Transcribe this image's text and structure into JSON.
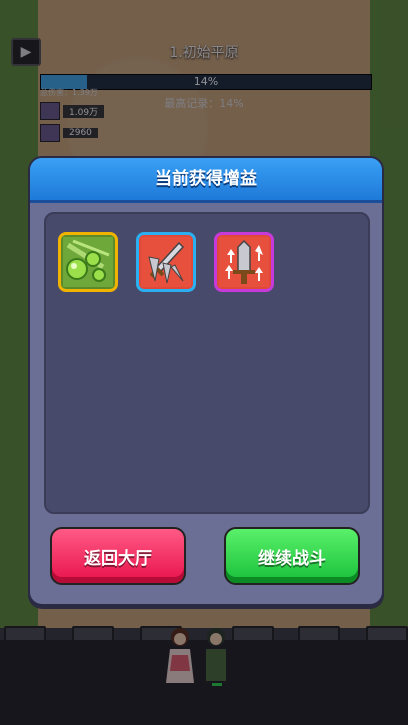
{
  "hud": {
    "stage_title": "1.初始平原",
    "progress_text": "14%",
    "progress_value": 0.14,
    "record_text": "最高记录：14%",
    "total_damage": "总伤害：1.39万",
    "rank1_value": "1.09万",
    "rank2_value": "2960"
  },
  "modal": {
    "title": "当前获得增益",
    "buffs": [
      {
        "icon": "green-orbs-icon"
      },
      {
        "icon": "sword-spikes-icon"
      },
      {
        "icon": "sword-upgrade-icon"
      }
    ],
    "return_button": "返回大厅",
    "continue_button": "继续战斗"
  },
  "colors": {
    "header_blue": "#2a8ee8",
    "return_red": "#f0245a",
    "continue_green": "#2ad44a",
    "slot_gold": "#f0b400",
    "slot_blue": "#2ab0f0",
    "slot_purple": "#c53ad8"
  }
}
